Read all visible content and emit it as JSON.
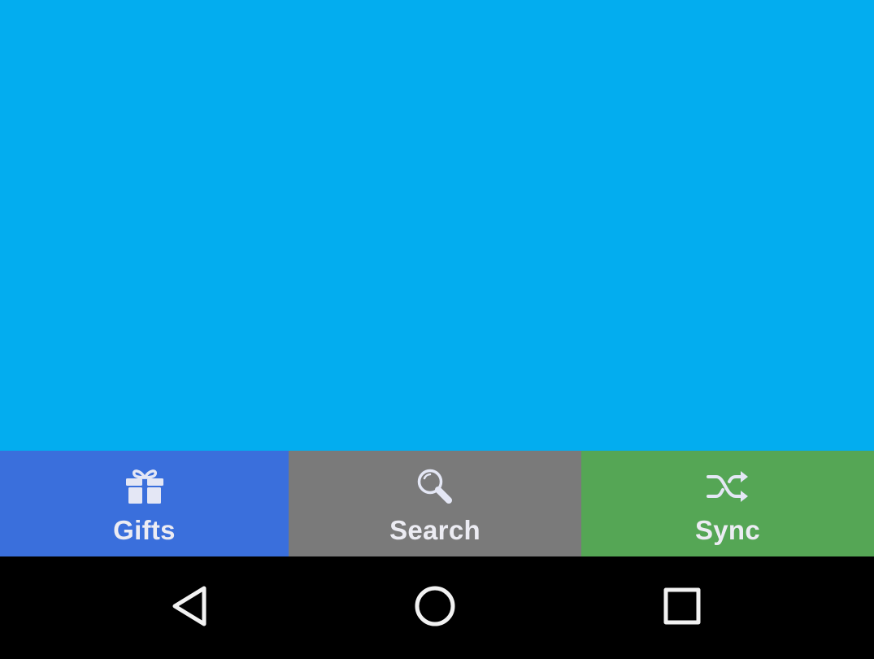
{
  "colors": {
    "content_background": "#03adef",
    "tab_gifts": "#3a6fdc",
    "tab_search": "#7a7a7a",
    "tab_sync": "#55a655",
    "tab_icon": "#e4e7f5",
    "navbar_background": "#000000",
    "navbar_icon": "#f2f2f2"
  },
  "tabs": [
    {
      "label": "Gifts",
      "icon": "gift-icon"
    },
    {
      "label": "Search",
      "icon": "search-icon"
    },
    {
      "label": "Sync",
      "icon": "shuffle-icon"
    }
  ],
  "navbar": {
    "buttons": [
      {
        "icon": "back-triangle-icon"
      },
      {
        "icon": "home-circle-icon"
      },
      {
        "icon": "recents-square-icon"
      }
    ]
  }
}
